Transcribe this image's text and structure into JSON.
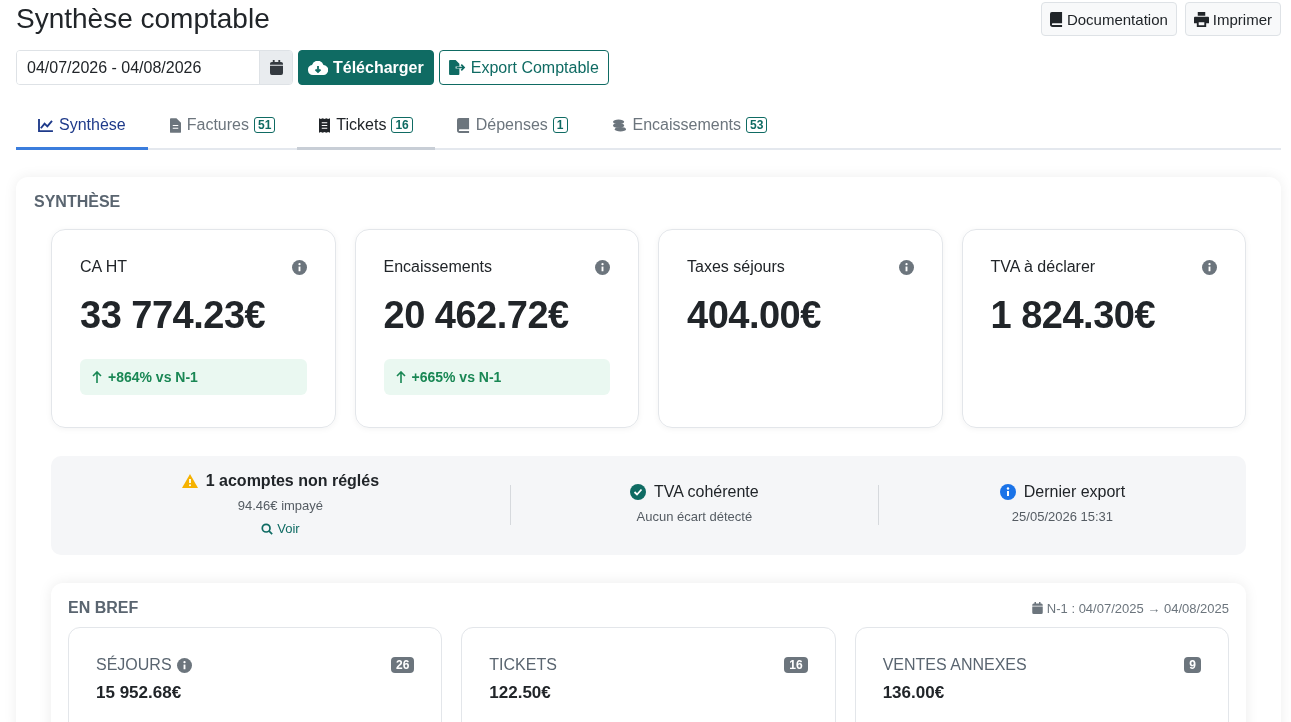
{
  "title": "Synthèse comptable",
  "header_buttons": [
    {
      "label": "Documentation"
    },
    {
      "label": "Imprimer"
    }
  ],
  "date_range": {
    "value": "04/07/2026 - 04/08/2026"
  },
  "actions": [
    {
      "label": "Télécharger",
      "kind": "primary"
    },
    {
      "label": "Export Comptable",
      "kind": "outline"
    }
  ],
  "tabs": [
    {
      "label": "Synthèse",
      "selected": true,
      "hovered": false
    },
    {
      "label": "Factures",
      "count": "51",
      "selected": false,
      "hovered": false
    },
    {
      "label": "Tickets",
      "count": "16",
      "selected": false,
      "hovered": true
    },
    {
      "label": "Dépenses",
      "count": "1",
      "selected": false,
      "hovered": false
    },
    {
      "label": "Encaissements",
      "count": "53",
      "selected": false,
      "hovered": false
    }
  ],
  "section_title": "SYNTHÈSE",
  "kpis": [
    {
      "label": "CA HT",
      "value": "33 774.23€",
      "trend": "+864% vs N-1"
    },
    {
      "label": "Encaissements",
      "value": "20 462.72€",
      "trend": "+665% vs N-1"
    },
    {
      "label": "Taxes séjours",
      "value": "404.00€"
    },
    {
      "label": "TVA à déclarer",
      "value": "1 824.30€"
    }
  ],
  "alerts": [
    {
      "kind": "warning",
      "title": "1 acomptes non réglés",
      "detail": "94.46€ impayé",
      "link": "Voir"
    },
    {
      "kind": "success",
      "title": "TVA cohérente",
      "detail": "Aucun écart détecté"
    },
    {
      "kind": "info",
      "title": "Dernier export",
      "detail": "25/05/2026 15:31"
    }
  ],
  "brief": {
    "title": "EN BREF",
    "comparison": "N-1 : 04/07/2025 → 04/08/2025",
    "cards": [
      {
        "label": "SÉJOURS",
        "info": true,
        "count": "26",
        "value": "15 952.68€"
      },
      {
        "label": "TICKETS",
        "info": false,
        "count": "16",
        "value": "122.50€"
      },
      {
        "label": "VENTES ANNEXES",
        "info": false,
        "count": "9",
        "value": "136.00€"
      }
    ]
  }
}
